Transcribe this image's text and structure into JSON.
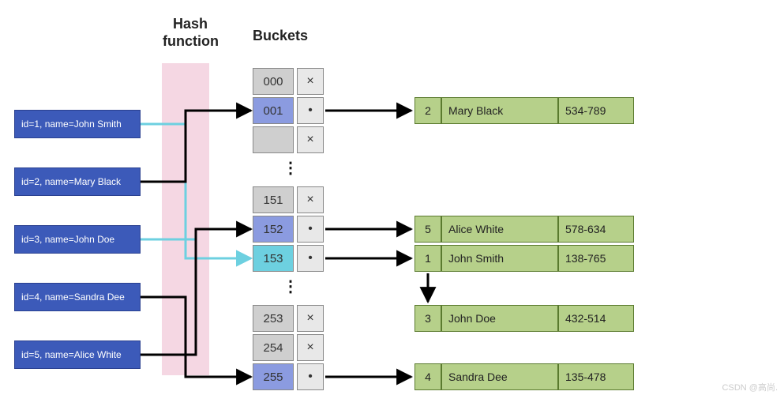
{
  "titles": {
    "hash": "Hash\nfunction",
    "buckets": "Buckets"
  },
  "inputs": [
    {
      "label": "id=1, name=John Smith"
    },
    {
      "label": "id=2, name=Mary Black"
    },
    {
      "label": "id=3, name=John Doe"
    },
    {
      "label": "id=4, name=Sandra Dee"
    },
    {
      "label": "id=5, name=Alice White"
    }
  ],
  "buckets": {
    "g1": [
      {
        "idx": "000",
        "ptr": "×",
        "color": "gray"
      },
      {
        "idx": "001",
        "ptr": "•",
        "color": "blue"
      },
      {
        "idx": "",
        "ptr": "×",
        "color": "gray"
      }
    ],
    "g2": [
      {
        "idx": "151",
        "ptr": "×",
        "color": "gray"
      },
      {
        "idx": "152",
        "ptr": "•",
        "color": "blue"
      },
      {
        "idx": "153",
        "ptr": "•",
        "color": "cyan"
      }
    ],
    "g3": [
      {
        "idx": "253",
        "ptr": "×",
        "color": "gray"
      },
      {
        "idx": "254",
        "ptr": "×",
        "color": "gray"
      },
      {
        "idx": "255",
        "ptr": "•",
        "color": "blue"
      }
    ]
  },
  "records": [
    {
      "id": "2",
      "name": "Mary Black",
      "phone": "534-789"
    },
    {
      "id": "5",
      "name": "Alice White",
      "phone": "578-634"
    },
    {
      "id": "1",
      "name": "John Smith",
      "phone": "138-765"
    },
    {
      "id": "3",
      "name": "John Doe",
      "phone": "432-514"
    },
    {
      "id": "4",
      "name": "Sandra Dee",
      "phone": "135-478"
    }
  ],
  "ellipsis": "⋮",
  "watermark": "CSDN @高尚."
}
